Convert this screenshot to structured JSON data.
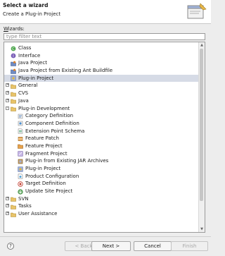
{
  "header": {
    "title": "Select a wizard",
    "subtitle": "Create a Plug-in Project"
  },
  "wizards_label": {
    "underlined": "W",
    "rest": "izards:"
  },
  "filter": {
    "placeholder": "type filter text",
    "value": ""
  },
  "tree": {
    "rows": [
      {
        "label": "Class",
        "icon": "class-icon",
        "indent": 1,
        "expand": "",
        "selected": false
      },
      {
        "label": "Interface",
        "icon": "interface-icon",
        "indent": 1,
        "expand": "",
        "selected": false
      },
      {
        "label": "Java Project",
        "icon": "java-project-icon",
        "indent": 1,
        "expand": "",
        "selected": false
      },
      {
        "label": "Java Project from Existing Ant Buildfile",
        "icon": "java-project-icon",
        "indent": 1,
        "expand": "",
        "selected": false
      },
      {
        "label": "Plug-in Project",
        "icon": "plugin-project-icon",
        "indent": 1,
        "expand": "",
        "selected": true
      },
      {
        "label": "General",
        "icon": "folder-icon",
        "indent": 0,
        "expand": "+",
        "selected": false
      },
      {
        "label": "CVS",
        "icon": "folder-icon",
        "indent": 0,
        "expand": "+",
        "selected": false
      },
      {
        "label": "Java",
        "icon": "folder-icon",
        "indent": 0,
        "expand": "+",
        "selected": false
      },
      {
        "label": "Plug-in Development",
        "icon": "folder-icon",
        "indent": 0,
        "expand": "-",
        "selected": false
      },
      {
        "label": "Category Definition",
        "icon": "category-definition-icon",
        "indent": 2,
        "expand": "",
        "selected": false
      },
      {
        "label": "Component Definition",
        "icon": "component-definition-icon",
        "indent": 2,
        "expand": "",
        "selected": false
      },
      {
        "label": "Extension Point Schema",
        "icon": "schema-icon",
        "indent": 2,
        "expand": "",
        "selected": false
      },
      {
        "label": "Feature Patch",
        "icon": "feature-patch-icon",
        "indent": 2,
        "expand": "",
        "selected": false
      },
      {
        "label": "Feature Project",
        "icon": "feature-project-icon",
        "indent": 2,
        "expand": "",
        "selected": false
      },
      {
        "label": "Fragment Project",
        "icon": "fragment-project-icon",
        "indent": 2,
        "expand": "",
        "selected": false
      },
      {
        "label": "Plug-in from Existing JAR Archives",
        "icon": "jar-plugin-icon",
        "indent": 2,
        "expand": "",
        "selected": false
      },
      {
        "label": "Plug-in Project",
        "icon": "plugin-project-icon",
        "indent": 2,
        "expand": "",
        "selected": false
      },
      {
        "label": "Product Configuration",
        "icon": "product-configuration-icon",
        "indent": 2,
        "expand": "",
        "selected": false
      },
      {
        "label": "Target Definition",
        "icon": "target-definition-icon",
        "indent": 2,
        "expand": "",
        "selected": false
      },
      {
        "label": "Update Site Project",
        "icon": "update-site-icon",
        "indent": 2,
        "expand": "",
        "selected": false
      },
      {
        "label": "SVN",
        "icon": "folder-icon",
        "indent": 0,
        "expand": "+",
        "selected": false
      },
      {
        "label": "Tasks",
        "icon": "folder-icon",
        "indent": 0,
        "expand": "+",
        "selected": false
      },
      {
        "label": "User Assistance",
        "icon": "folder-icon",
        "indent": 0,
        "expand": "+",
        "selected": false
      }
    ]
  },
  "buttons": {
    "help": "?",
    "back": "< Back",
    "next": "Next >",
    "cancel": "Cancel",
    "finish": "Finish"
  },
  "colors": {
    "selection": "#d6dbe6",
    "folder": "#e9c46a",
    "plugin": "#7b8fc7"
  }
}
